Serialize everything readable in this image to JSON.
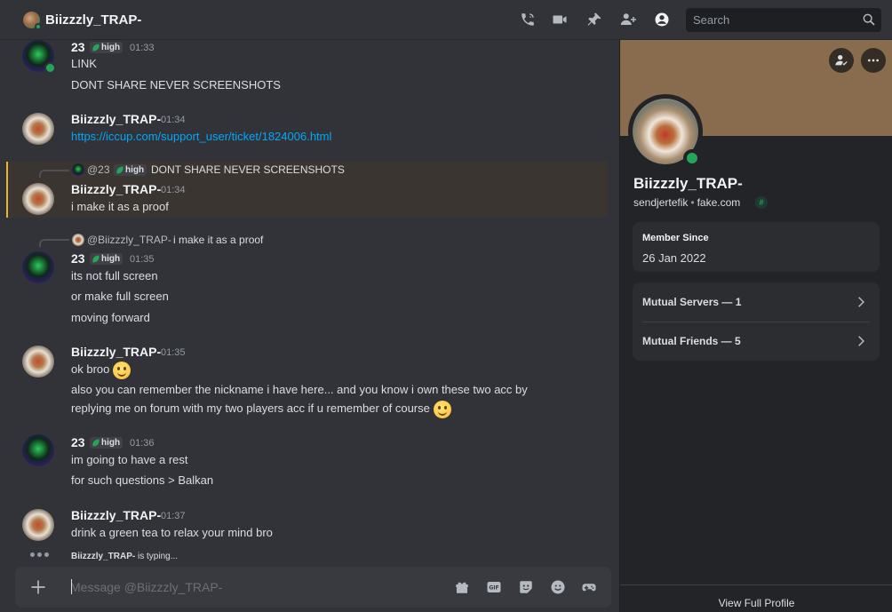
{
  "header": {
    "title": "Biizzzly_TRAP-",
    "icons": [
      "phone-call-icon",
      "video-call-icon",
      "pin-icon",
      "add-friends-icon",
      "user-profile-icon"
    ],
    "search_placeholder": "Search"
  },
  "messages": [
    {
      "author": "23",
      "tag": "high",
      "time": "01:33",
      "lines": [
        "LINK",
        "DONT SHARE NEVER SCREENSHOTS"
      ]
    },
    {
      "author": "Biizzzly_TRAP-",
      "time": "01:34",
      "link": "https://iccup.com/support_user/ticket/1824006.html"
    },
    {
      "reply_to": {
        "author": "@23",
        "tag": "high",
        "text": "DONT SHARE NEVER SCREENSHOTS"
      },
      "author": "Biizzzly_TRAP-",
      "time": "01:34",
      "lines": [
        "i make it as a proof"
      ]
    },
    {
      "reply_to": {
        "author": "@Biizzzly_TRAP-",
        "text": "i make it as a proof"
      },
      "author": "23",
      "tag": "high",
      "time": "01:35",
      "lines": [
        "its not full screen",
        "or make full screen",
        "moving forward"
      ]
    },
    {
      "author": "Biizzzly_TRAP-",
      "time": "01:35",
      "lines": [
        "ok broo",
        "also you can remember the nickname i have here... and you know i own these two acc by",
        "replying me on forum with my two players acc if u remember of course"
      ]
    },
    {
      "author": "23",
      "tag": "high",
      "time": "01:36",
      "lines": [
        "im going to have a rest",
        "for such questions > Balkan"
      ]
    },
    {
      "author": "Biizzzly_TRAP-",
      "time": "01:37",
      "lines": [
        "drink a green tea to relax your mind bro"
      ]
    }
  ],
  "typing": {
    "user": "Biizzzly_TRAP-",
    "suffix": " is typing..."
  },
  "composer": {
    "placeholder": "Message @Biizzzly_TRAP-",
    "gif_label": "GIF"
  },
  "profile": {
    "display_name": "Biizzzly_TRAP-",
    "username": "sendjertefik",
    "separator": "•",
    "pronouns": "fake.com",
    "badge": "#",
    "member_since_label": "Member Since",
    "member_since_value": "26 Jan 2022",
    "mutual_servers": "Mutual Servers — 1",
    "mutual_friends": "Mutual Friends — 5",
    "view_full_profile": "View Full Profile"
  },
  "colors": {
    "accent_online": "#23a55a",
    "link": "#00a8fc",
    "highlight_border": "#f0b232",
    "banner": "#886c4d"
  }
}
